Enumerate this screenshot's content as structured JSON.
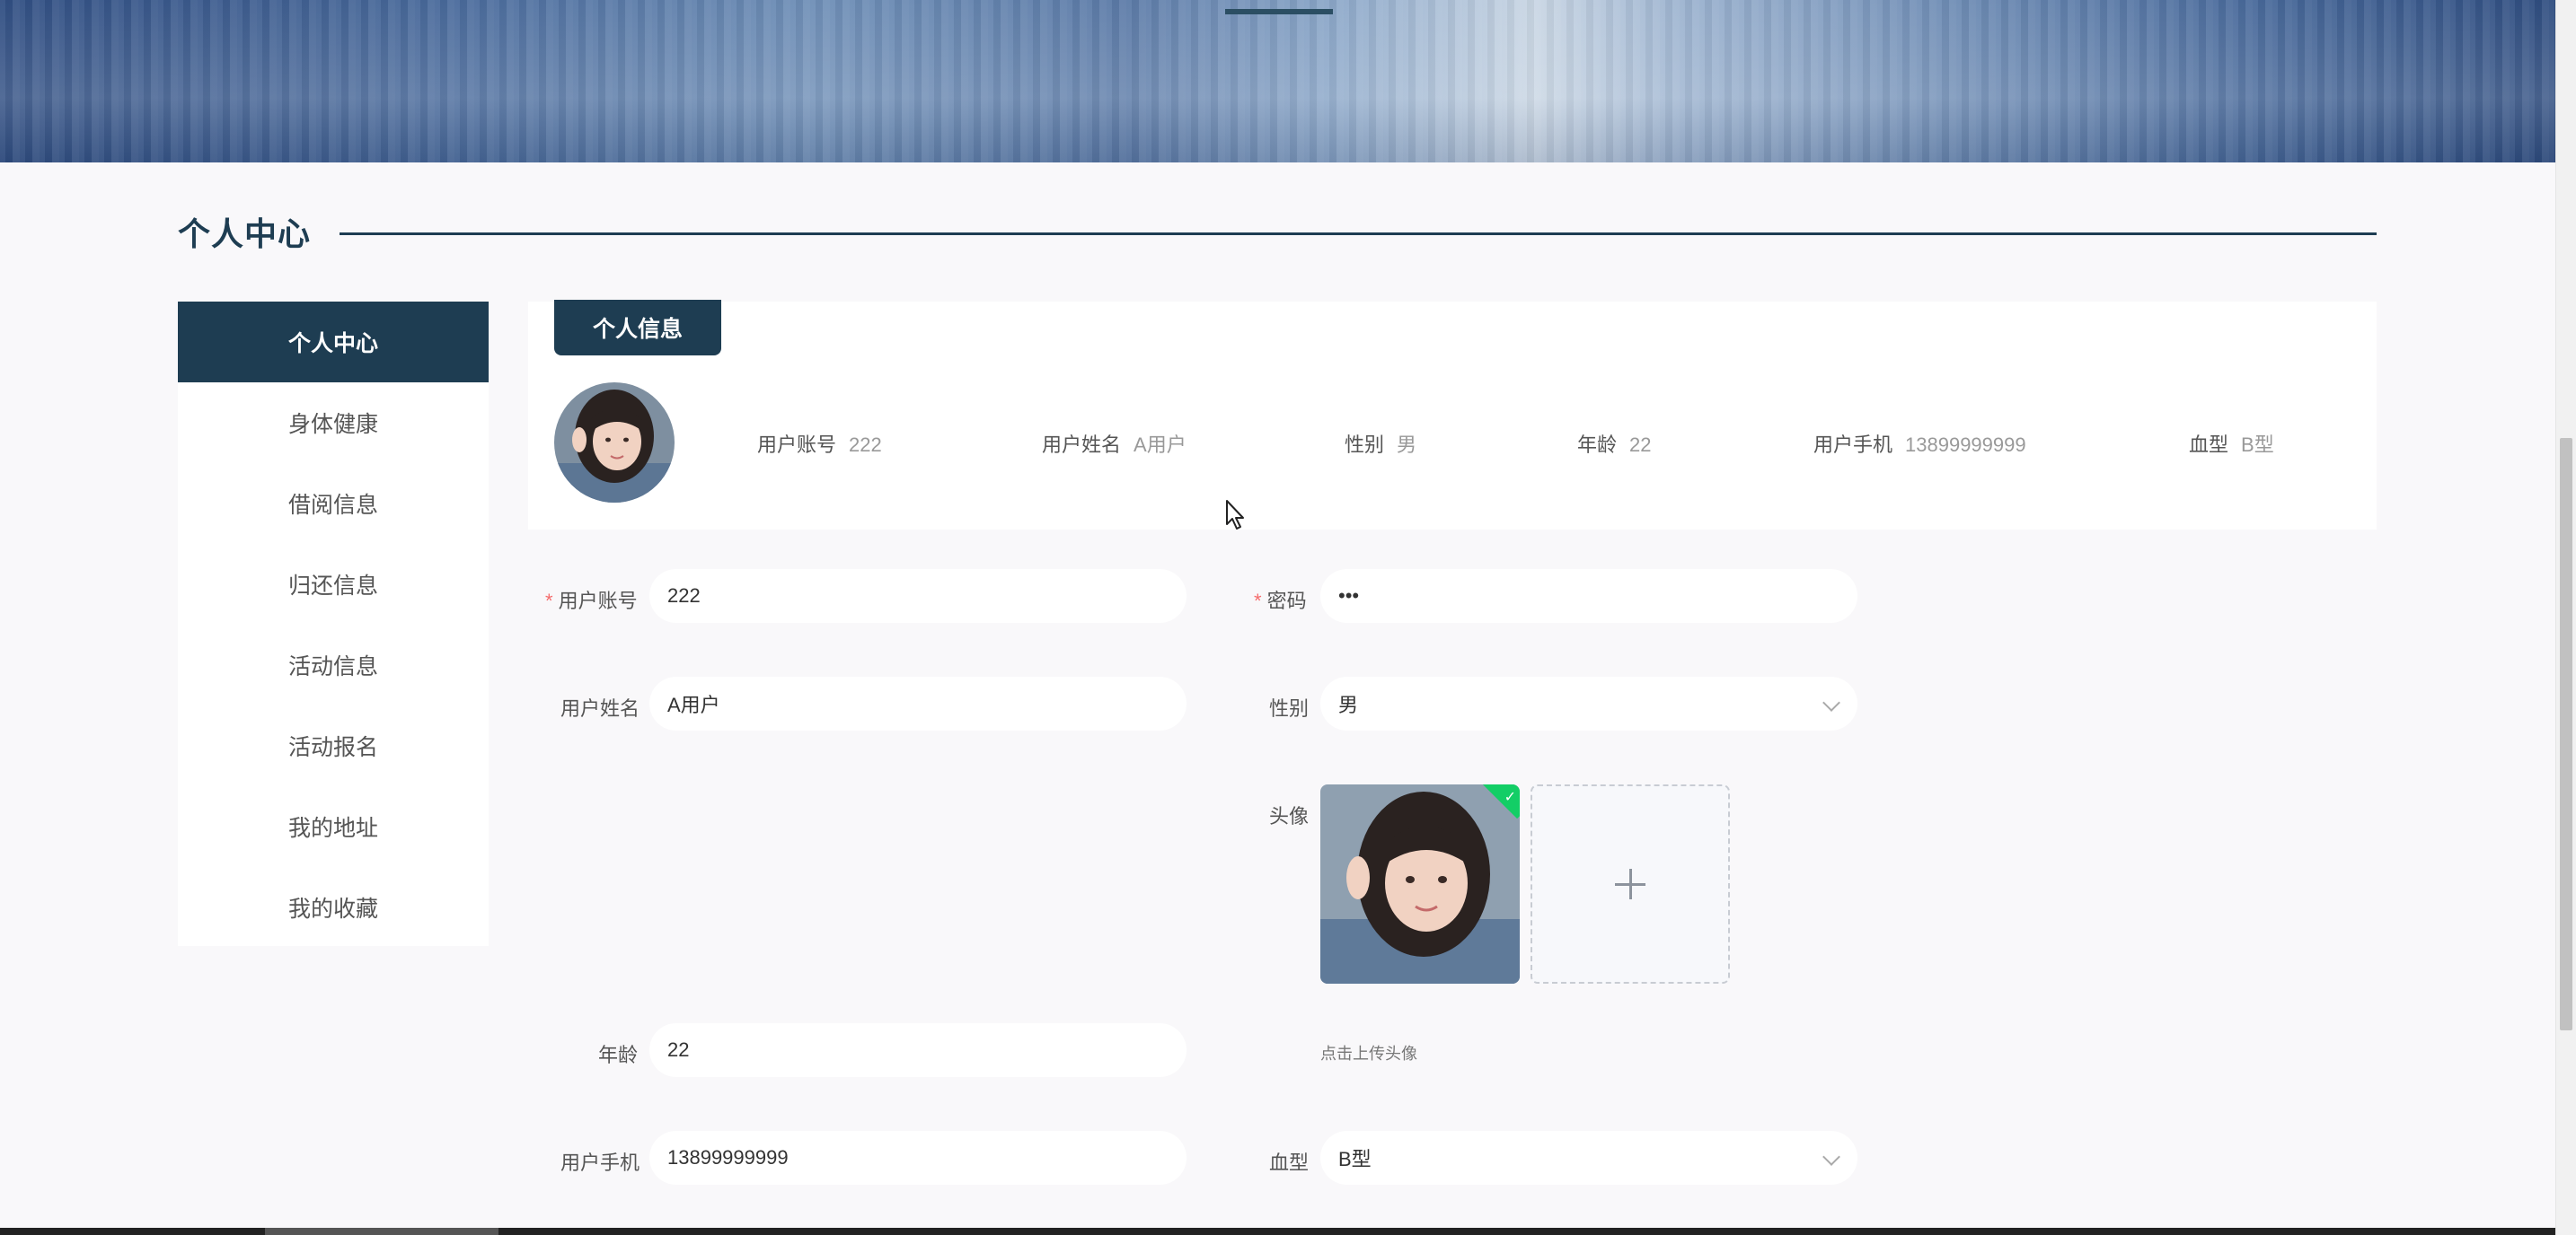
{
  "section": {
    "title": "个人中心"
  },
  "sidebar": {
    "items": [
      {
        "label": "个人中心",
        "active": true
      },
      {
        "label": "身体健康"
      },
      {
        "label": "借阅信息"
      },
      {
        "label": "归还信息"
      },
      {
        "label": "活动信息"
      },
      {
        "label": "活动报名"
      },
      {
        "label": "我的地址"
      },
      {
        "label": "我的收藏"
      }
    ]
  },
  "info": {
    "tab_label": "个人信息",
    "fields": [
      {
        "label": "用户账号",
        "value": "222"
      },
      {
        "label": "用户姓名",
        "value": "A用户"
      },
      {
        "label": "性别",
        "value": "男"
      },
      {
        "label": "年龄",
        "value": "22"
      },
      {
        "label": "用户手机",
        "value": "13899999999"
      },
      {
        "label": "血型",
        "value": "B型"
      }
    ]
  },
  "form": {
    "account": {
      "label": "用户账号",
      "value": "222"
    },
    "password": {
      "label": "密码",
      "value": "•••"
    },
    "name": {
      "label": "用户姓名",
      "value": "A用户"
    },
    "gender": {
      "label": "性别",
      "value": "男"
    },
    "avatar": {
      "label": "头像",
      "tip": "点击上传头像"
    },
    "age": {
      "label": "年龄",
      "value": "22"
    },
    "phone": {
      "label": "用户手机",
      "value": "13899999999"
    },
    "blood": {
      "label": "血型",
      "value": "B型"
    }
  },
  "colors": {
    "primary": "#1e3d52",
    "required": "#f56c6c",
    "success": "#13ce66"
  }
}
